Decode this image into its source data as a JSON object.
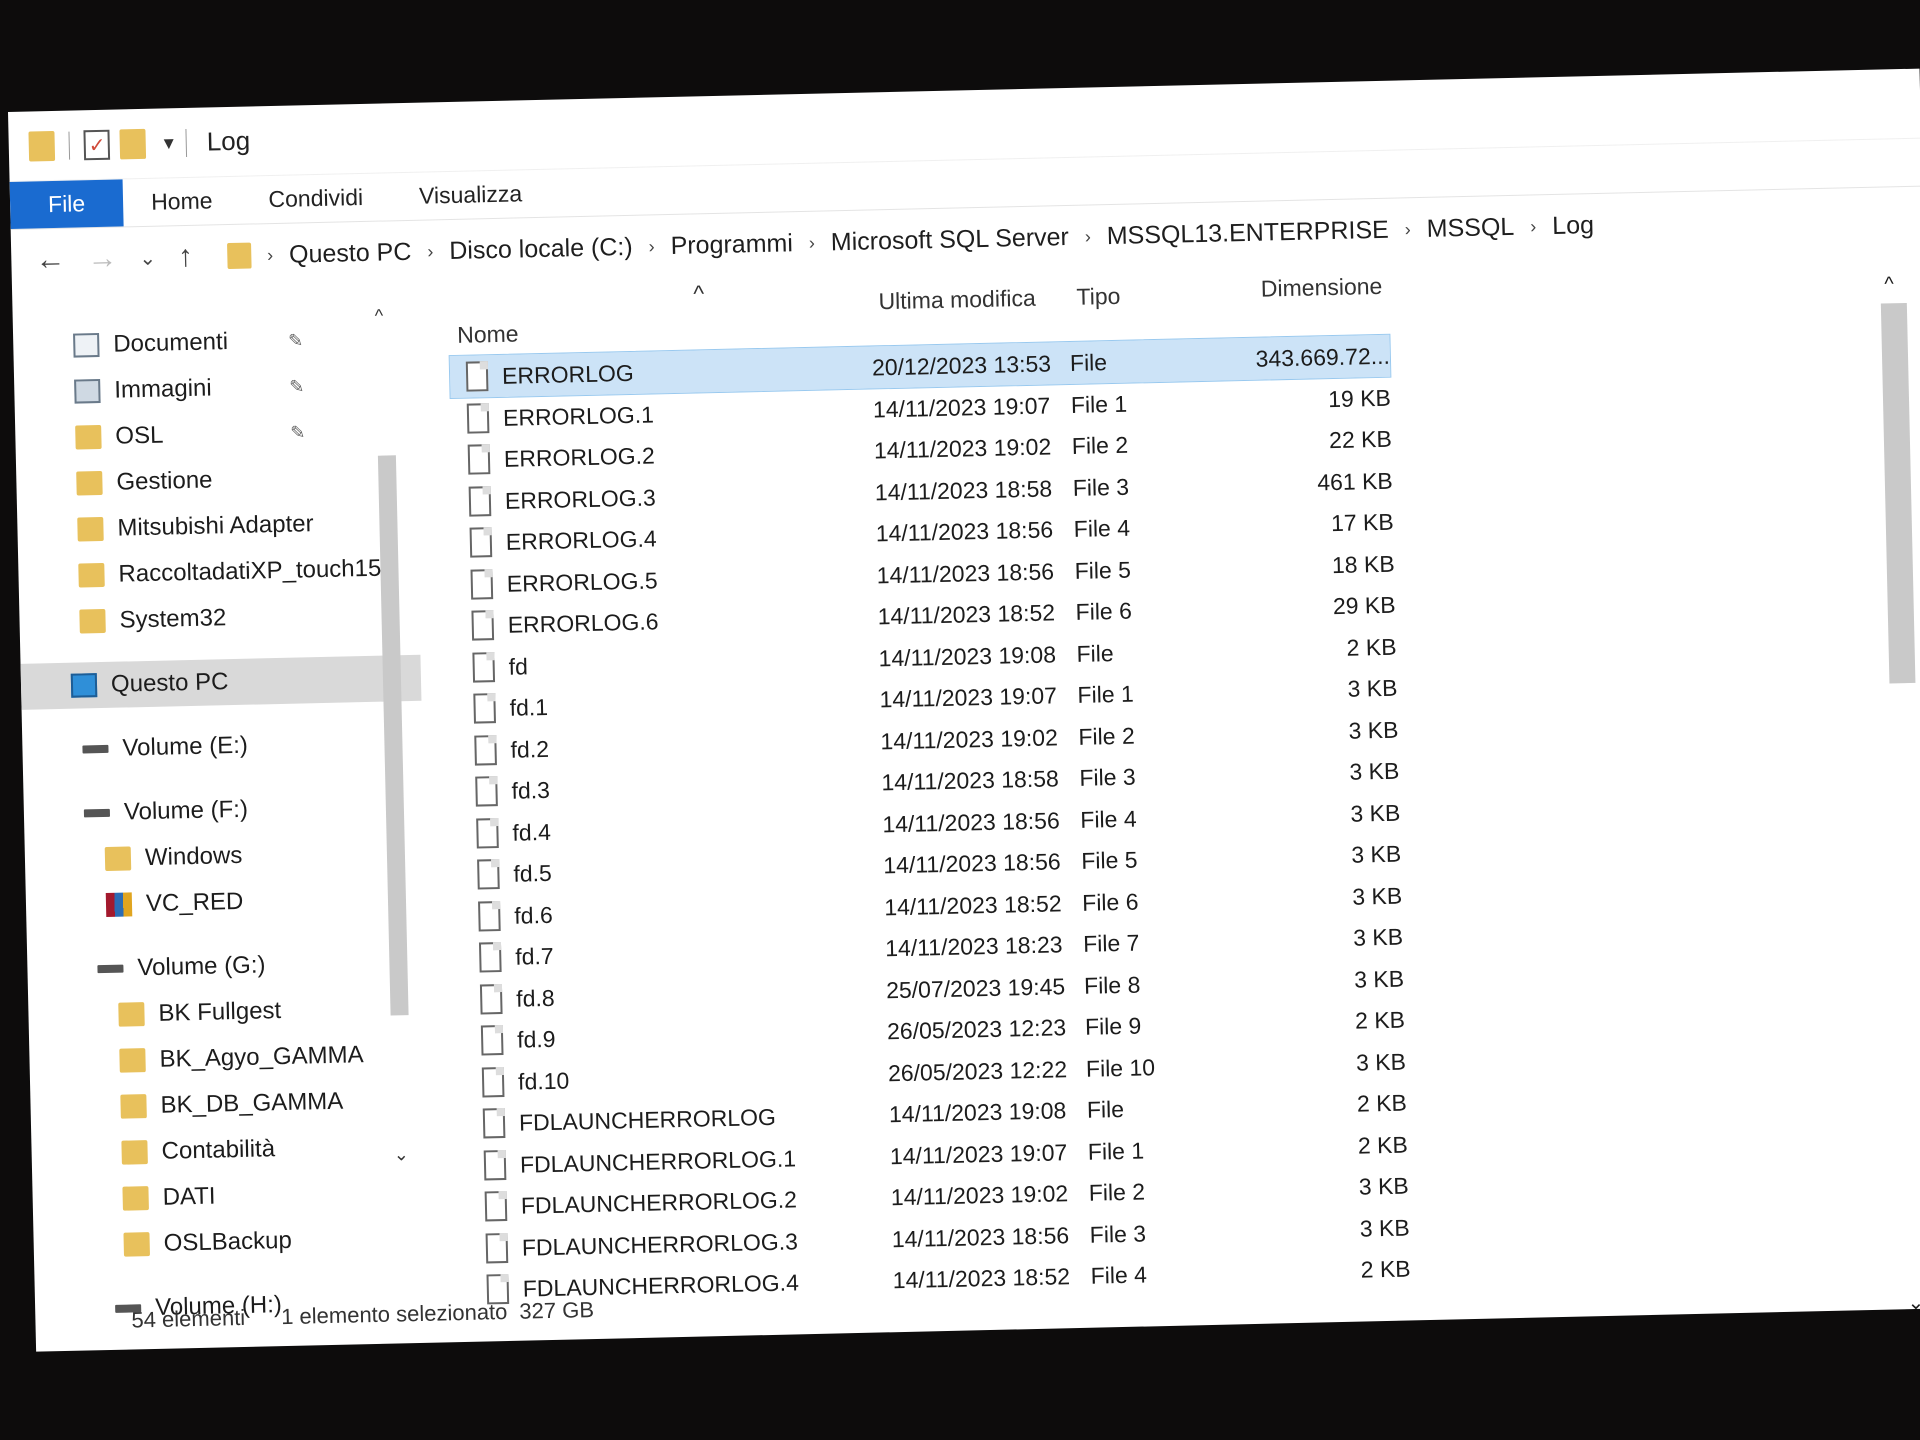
{
  "window": {
    "title": "Log",
    "ribbon_tabs": [
      "File",
      "Home",
      "Condividi",
      "Visualizza"
    ]
  },
  "address": {
    "crumbs": [
      "Questo PC",
      "Disco locale (C:)",
      "Programmi",
      "Microsoft SQL Server",
      "MSSQL13.ENTERPRISE",
      "MSSQL",
      "Log"
    ]
  },
  "nav": {
    "items": [
      {
        "label": "Documenti",
        "icon": "documents-icon",
        "pinned": true
      },
      {
        "label": "Immagini",
        "icon": "pictures-icon",
        "pinned": true
      },
      {
        "label": "OSL",
        "icon": "folder-icon",
        "pinned": true
      },
      {
        "label": "Gestione",
        "icon": "folder-icon"
      },
      {
        "label": "Mitsubishi Adapter",
        "icon": "folder-icon"
      },
      {
        "label": "RaccoltadatiXP_touch15",
        "icon": "folder-icon"
      },
      {
        "label": "System32",
        "icon": "folder-icon"
      },
      {
        "label": "Questo PC",
        "icon": "computer-icon"
      },
      {
        "label": "Volume (E:)",
        "icon": "drive-icon"
      },
      {
        "label": "Volume (F:)",
        "icon": "drive-icon"
      },
      {
        "label": "Windows",
        "icon": "folder-icon"
      },
      {
        "label": "VC_RED",
        "icon": "archive-icon"
      },
      {
        "label": "Volume (G:)",
        "icon": "drive-icon"
      },
      {
        "label": "BK Fullgest",
        "icon": "folder-icon"
      },
      {
        "label": "BK_Agyo_GAMMA",
        "icon": "folder-icon"
      },
      {
        "label": "BK_DB_GAMMA",
        "icon": "folder-icon"
      },
      {
        "label": "Contabilità",
        "icon": "folder-icon"
      },
      {
        "label": "DATI",
        "icon": "folder-icon"
      },
      {
        "label": "OSLBackup",
        "icon": "folder-icon"
      },
      {
        "label": "Volume (H:)",
        "icon": "drive-icon"
      }
    ]
  },
  "columns": {
    "name": "Nome",
    "date": "Ultima modifica",
    "type": "Tipo",
    "size": "Dimensione"
  },
  "files": [
    {
      "name": "ERRORLOG",
      "date": "20/12/2023 13:53",
      "type": "File",
      "size": "343.669.72..."
    },
    {
      "name": "ERRORLOG.1",
      "date": "14/11/2023 19:07",
      "type": "File 1",
      "size": "19 KB"
    },
    {
      "name": "ERRORLOG.2",
      "date": "14/11/2023 19:02",
      "type": "File 2",
      "size": "22 KB"
    },
    {
      "name": "ERRORLOG.3",
      "date": "14/11/2023 18:58",
      "type": "File 3",
      "size": "461 KB"
    },
    {
      "name": "ERRORLOG.4",
      "date": "14/11/2023 18:56",
      "type": "File 4",
      "size": "17 KB"
    },
    {
      "name": "ERRORLOG.5",
      "date": "14/11/2023 18:56",
      "type": "File 5",
      "size": "18 KB"
    },
    {
      "name": "ERRORLOG.6",
      "date": "14/11/2023 18:52",
      "type": "File 6",
      "size": "29 KB"
    },
    {
      "name": "fd",
      "date": "14/11/2023 19:08",
      "type": "File",
      "size": "2 KB"
    },
    {
      "name": "fd.1",
      "date": "14/11/2023 19:07",
      "type": "File 1",
      "size": "3 KB"
    },
    {
      "name": "fd.2",
      "date": "14/11/2023 19:02",
      "type": "File 2",
      "size": "3 KB"
    },
    {
      "name": "fd.3",
      "date": "14/11/2023 18:58",
      "type": "File 3",
      "size": "3 KB"
    },
    {
      "name": "fd.4",
      "date": "14/11/2023 18:56",
      "type": "File 4",
      "size": "3 KB"
    },
    {
      "name": "fd.5",
      "date": "14/11/2023 18:56",
      "type": "File 5",
      "size": "3 KB"
    },
    {
      "name": "fd.6",
      "date": "14/11/2023 18:52",
      "type": "File 6",
      "size": "3 KB"
    },
    {
      "name": "fd.7",
      "date": "14/11/2023 18:23",
      "type": "File 7",
      "size": "3 KB"
    },
    {
      "name": "fd.8",
      "date": "25/07/2023 19:45",
      "type": "File 8",
      "size": "3 KB"
    },
    {
      "name": "fd.9",
      "date": "26/05/2023 12:23",
      "type": "File 9",
      "size": "2 KB"
    },
    {
      "name": "fd.10",
      "date": "26/05/2023 12:22",
      "type": "File 10",
      "size": "3 KB"
    },
    {
      "name": "FDLAUNCHERRORLOG",
      "date": "14/11/2023 19:08",
      "type": "File",
      "size": "2 KB"
    },
    {
      "name": "FDLAUNCHERRORLOG.1",
      "date": "14/11/2023 19:07",
      "type": "File 1",
      "size": "2 KB"
    },
    {
      "name": "FDLAUNCHERRORLOG.2",
      "date": "14/11/2023 19:02",
      "type": "File 2",
      "size": "3 KB"
    },
    {
      "name": "FDLAUNCHERRORLOG.3",
      "date": "14/11/2023 18:56",
      "type": "File 3",
      "size": "3 KB"
    },
    {
      "name": "FDLAUNCHERRORLOG.4",
      "date": "14/11/2023 18:52",
      "type": "File 4",
      "size": "2 KB"
    }
  ],
  "status": {
    "count": "54 elementi",
    "selected": "1 elemento selezionato",
    "size": "327 GB"
  },
  "icons": {
    "back": "←",
    "forward": "→",
    "recent": "⌄",
    "up": "↑",
    "pin": "📌",
    "breadcrumb_sep": "›"
  }
}
